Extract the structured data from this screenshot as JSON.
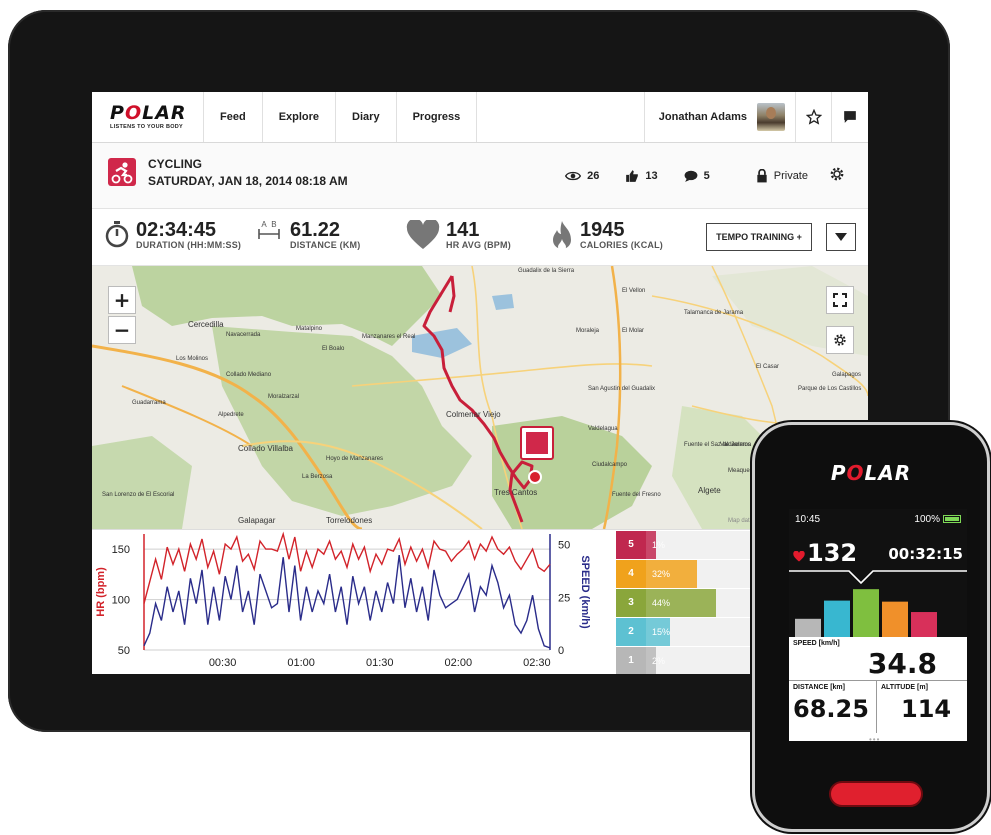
{
  "brand": {
    "logo_pre": "P",
    "logo_o": "O",
    "logo_post": "LAR",
    "logo_text": "POLAR",
    "tagline": "LISTENS TO YOUR BODY"
  },
  "nav": {
    "items": [
      {
        "label": "Feed"
      },
      {
        "label": "Explore"
      },
      {
        "label": "Diary"
      },
      {
        "label": "Progress"
      }
    ],
    "user_name": "Jonathan Adams",
    "icons": [
      "star-icon",
      "message-icon"
    ]
  },
  "activity": {
    "type": "CYCLING",
    "date": "SATURDAY, JAN 18, 2014 08:18 AM",
    "views": "26",
    "likes": "13",
    "comments": "5",
    "privacy": "Private"
  },
  "summary": {
    "duration": {
      "value": "02:34:45",
      "label": "DURATION (HH:MM:SS)"
    },
    "distance": {
      "value": "61.22",
      "label": "DISTANCE (KM)",
      "icon_a": "A",
      "icon_b": "B"
    },
    "hr_avg": {
      "value": "141",
      "label": "HR AVG (BPM)"
    },
    "calories": {
      "value": "1945",
      "label": "CALORIES (KCAL)"
    },
    "tempo_button": "TEMPO TRAINING +"
  },
  "map": {
    "zoom_in": "+",
    "zoom_out": "−",
    "places": {
      "cercedilla": "Cercedilla",
      "navacerrada": "Navacerrada",
      "matalpino": "Matalpino",
      "el_boalo": "El Boalo",
      "manzanares": "Manzanares el Real",
      "los_molinos": "Los Molinos",
      "collado_mediano": "Collado Mediano",
      "guadarrama": "Guadarrama",
      "moralzarzal": "Moralzarzal",
      "alpedrete": "Alpedrete",
      "collado_villalba": "Collado Villalba",
      "hoyo": "Hoyo de Manzanares",
      "la_berzosa": "La Berzosa",
      "san_lorenzo": "San Lorenzo de El Escorial",
      "galapagar": "Galapagar",
      "torrelodones": "Torrelodones",
      "colmenar": "Colmenar Viejo",
      "tres_cantos": "Tres Cantos",
      "guadalix": "Guadalix de la Sierra",
      "el_vellon": "El Vellon",
      "talamanca": "Talamanca de Jarama",
      "moraleja": "Moraleja",
      "el_molar": "El Molar",
      "san_agustin": "San Agustin del Guadalix",
      "valdelagua": "Valdelagua",
      "fuente_saz": "Fuente el Saz de Jarama",
      "valdeolmos": "Valdeolmos",
      "el_casar": "El Casar",
      "galapagos": "Galapagos",
      "parque": "Parque de Los Castillos",
      "algete": "Algete",
      "ciudalcampo": "Ciudalcampo",
      "fuente_fresno": "Fuente del Fresno",
      "meaques": "Meaques",
      "copyright": "Map data ©2013 Google"
    }
  },
  "chart_data": {
    "type": "line",
    "x_ticks": [
      "00:30",
      "01:00",
      "01:30",
      "02:00",
      "02:30"
    ],
    "y_left_label": "HR (bpm)",
    "y_left_ticks": [
      "150",
      "100",
      "50"
    ],
    "y_left_range": [
      50,
      165
    ],
    "y_right_label": "SPEED (km/h)",
    "y_right_ticks": [
      "50",
      "25",
      "0"
    ],
    "y_right_range": [
      0,
      55
    ],
    "x_range_minutes": [
      0,
      155
    ],
    "series": [
      {
        "color": "#d2232a",
        "values": [
          96,
          118,
          140,
          120,
          152,
          135,
          150,
          128,
          155,
          140,
          160,
          132,
          148,
          125,
          155,
          150,
          162,
          138,
          145,
          130,
          158,
          150,
          150,
          148,
          165,
          140,
          162,
          128,
          148,
          132,
          150,
          145,
          158,
          140,
          148,
          132,
          155,
          140,
          152,
          128,
          145,
          135,
          150,
          148,
          160,
          135,
          152,
          138,
          150,
          132,
          158,
          150,
          148,
          138,
          145,
          150,
          158,
          140,
          155,
          148,
          162,
          150,
          145,
          152,
          138,
          130,
          140,
          150,
          132,
          128,
          135
        ]
      },
      {
        "color": "#2a2c8a",
        "values": [
          2,
          8,
          22,
          14,
          30,
          18,
          28,
          12,
          34,
          22,
          38,
          12,
          30,
          14,
          35,
          24,
          40,
          18,
          28,
          12,
          36,
          28,
          20,
          22,
          44,
          18,
          40,
          14,
          30,
          18,
          28,
          22,
          36,
          18,
          30,
          12,
          35,
          22,
          30,
          14,
          28,
          18,
          32,
          22,
          45,
          20,
          34,
          18,
          30,
          14,
          38,
          26,
          20,
          22,
          24,
          30,
          36,
          18,
          30,
          26,
          40,
          32,
          20,
          26,
          12,
          8,
          14,
          26,
          10,
          2,
          1
        ]
      }
    ]
  },
  "zones": [
    {
      "num": "5",
      "pct": "1%",
      "share": 0.01,
      "color": "#c0284f"
    },
    {
      "num": "4",
      "pct": "32%",
      "share": 0.32,
      "color": "#f0a21c"
    },
    {
      "num": "3",
      "pct": "44%",
      "share": 0.44,
      "color": "#8aa63b"
    },
    {
      "num": "2",
      "pct": "15%",
      "share": 0.15,
      "color": "#5dc1d2"
    },
    {
      "num": "1",
      "pct": "2%",
      "share": 0.02,
      "color": "#b7b7b7"
    }
  ],
  "watch": {
    "logo_text": "POLAR",
    "time": "10:45",
    "battery": "100%",
    "hr": "132",
    "elapsed": "00:32:15",
    "speed_label": "SPEED [km/h]",
    "speed": "34.8",
    "distance_label": "DISTANCE [km]",
    "distance": "68.25",
    "altitude_label": "ALTITUDE [m]",
    "altitude": "114",
    "zone_bars": [
      {
        "color": "#b7b7b7",
        "level": 0.35
      },
      {
        "color": "#38b7d0",
        "level": 0.7
      },
      {
        "color": "#7fbf3f",
        "level": 0.92
      },
      {
        "color": "#f0902a",
        "level": 0.68
      },
      {
        "color": "#d8305a",
        "level": 0.48
      }
    ]
  },
  "colors": {
    "accent_red": "#d0102a",
    "hr_red": "#d2232a",
    "speed_blue": "#2a2c8a",
    "route_red": "#c81f3a"
  }
}
